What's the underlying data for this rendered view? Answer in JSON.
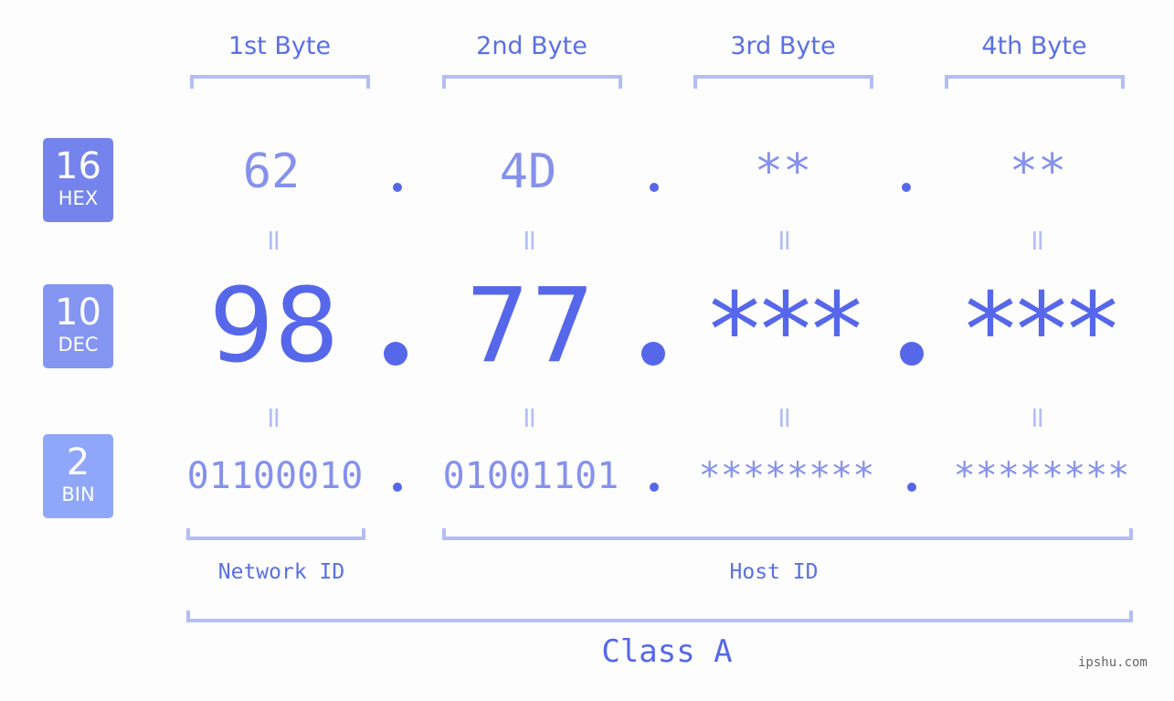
{
  "colors": {
    "hex_badge": "#7583ec",
    "dec_badge": "#8595f2",
    "bin_badge": "#8fa7f8",
    "accent": "#5667ea",
    "muted": "#8691ec",
    "bracket": "#b3bdf6",
    "background": "#fcfdfc"
  },
  "badges": [
    {
      "num": "16",
      "label": "HEX"
    },
    {
      "num": "10",
      "label": "DEC"
    },
    {
      "num": "2",
      "label": "BIN"
    }
  ],
  "byte_headers": [
    "1st Byte",
    "2nd Byte",
    "3rd Byte",
    "4th Byte"
  ],
  "hex": [
    "62",
    "4D",
    "**",
    "**"
  ],
  "dec": [
    "98",
    "77",
    "***",
    "***"
  ],
  "bin": [
    "01100010",
    "01001101",
    "********",
    "********"
  ],
  "equals": "=",
  "network_id_label": "Network ID",
  "host_id_label": "Host ID",
  "class_label": "Class A",
  "watermark": "ipshu.com"
}
